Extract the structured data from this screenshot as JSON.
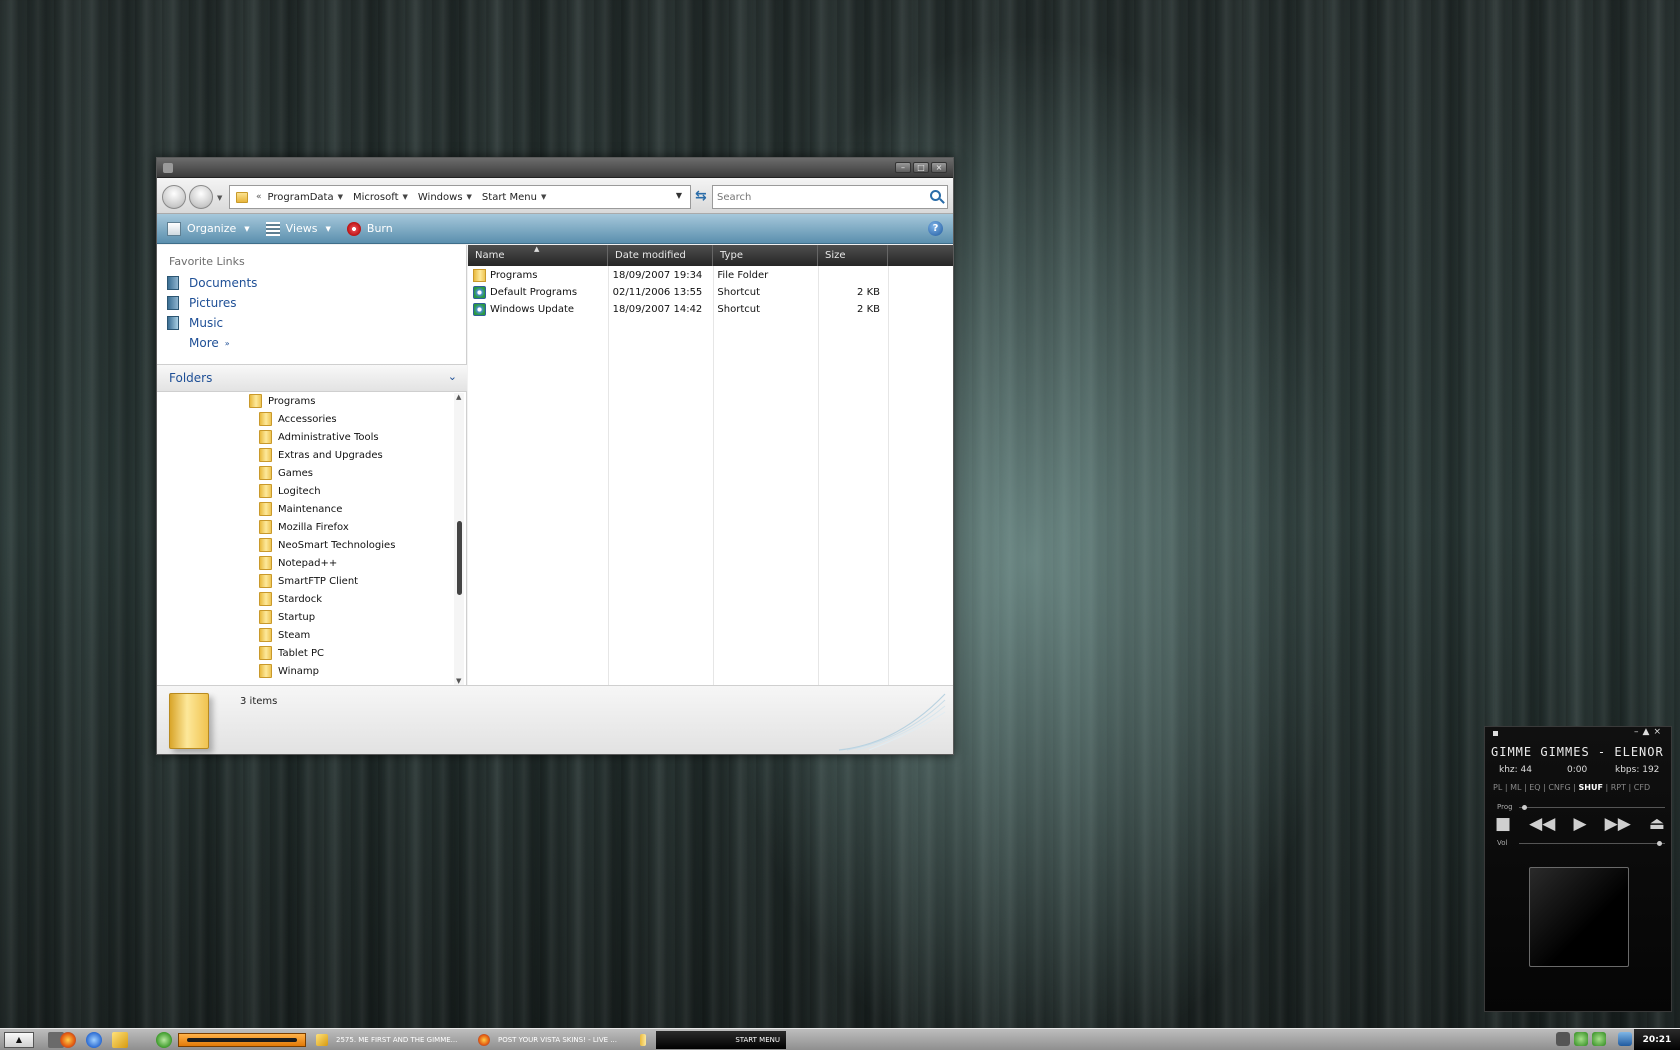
{
  "explorer": {
    "address": {
      "prefix": "«",
      "crumbs": [
        "ProgramData",
        "Microsoft",
        "Windows",
        "Start Menu"
      ]
    },
    "search": {
      "placeholder": "Search"
    },
    "toolbar": {
      "organize": "Organize",
      "views": "Views",
      "burn": "Burn",
      "help": "?"
    },
    "favorite_links": {
      "header": "Favorite Links",
      "items": [
        "Documents",
        "Pictures",
        "Music"
      ],
      "more": "More"
    },
    "folders": {
      "title": "Folders",
      "root": "Programs",
      "children": [
        "Accessories",
        "Administrative Tools",
        "Extras and Upgrades",
        "Games",
        "Logitech",
        "Maintenance",
        "Mozilla Firefox",
        "NeoSmart Technologies",
        "Notepad++",
        "SmartFTP Client",
        "Stardock",
        "Startup",
        "Steam",
        "Tablet PC",
        "Winamp"
      ]
    },
    "columns": [
      "Name",
      "Date modified",
      "Type",
      "Size"
    ],
    "files": [
      {
        "name": "Programs",
        "date": "18/09/2007 19:34",
        "type": "File Folder",
        "size": "",
        "icon": "folder-icon"
      },
      {
        "name": "Default Programs",
        "date": "02/11/2006 13:55",
        "type": "Shortcut",
        "size": "2 KB",
        "icon": "shortcut-icon"
      },
      {
        "name": "Windows Update",
        "date": "18/09/2007 14:42",
        "type": "Shortcut",
        "size": "2 KB",
        "icon": "shortcut-icon"
      }
    ],
    "status": {
      "items_count": "3 items"
    }
  },
  "winamp": {
    "title": "GIMME GIMMES - ELENOR",
    "khz": "khz: 44",
    "time": "0:00",
    "kbps": "kbps: 192",
    "modes": [
      "PL",
      "ML",
      "EQ",
      "CNFG",
      "SHUF",
      "RPT",
      "CFD"
    ],
    "active_mode": "SHUF",
    "prog_label": "Prog",
    "vol_label": "Vol",
    "progress": 0.02,
    "volume": 0.98
  },
  "taskbar": {
    "tasks": [
      "2575. ME FIRST AND THE GIMME...",
      "POST YOUR VISTA SKINS! - LIVE ...",
      "START MENU"
    ],
    "clock": "20:21"
  },
  "colors": {
    "command_bar": "#6a9ab8",
    "link_blue": "#1e4f96",
    "taskbar_progress": "#ff9c2a"
  }
}
